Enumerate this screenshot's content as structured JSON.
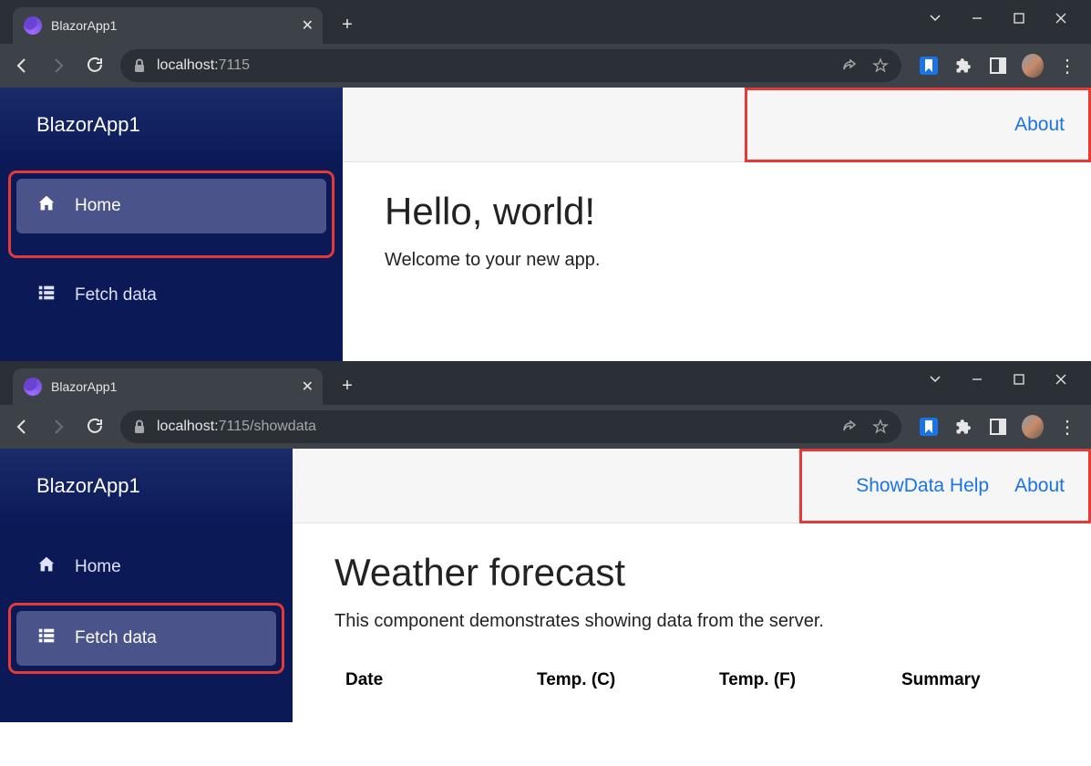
{
  "windows": [
    {
      "tab_title": "BlazorApp1",
      "url_host": "localhost:",
      "url_port": "7115",
      "url_path": "",
      "sidebar": {
        "brand": "BlazorApp1",
        "items": [
          {
            "label": "Home",
            "icon": "home-icon",
            "active": true
          },
          {
            "label": "Fetch data",
            "icon": "list-icon",
            "active": false
          }
        ]
      },
      "topbar_links": [
        "About"
      ],
      "page": {
        "heading": "Hello, world!",
        "intro": "Welcome to your new app."
      }
    },
    {
      "tab_title": "BlazorApp1",
      "url_host": "localhost:",
      "url_port": "7115",
      "url_path": "/showdata",
      "sidebar": {
        "brand": "BlazorApp1",
        "items": [
          {
            "label": "Home",
            "icon": "home-icon",
            "active": false
          },
          {
            "label": "Fetch data",
            "icon": "list-icon",
            "active": true
          }
        ]
      },
      "topbar_links": [
        "ShowData Help",
        "About"
      ],
      "page": {
        "heading": "Weather forecast",
        "intro": "This component demonstrates showing data from the server.",
        "table_headers": [
          "Date",
          "Temp. (C)",
          "Temp. (F)",
          "Summary"
        ]
      }
    }
  ],
  "icons": {
    "close": "✕",
    "plus": "+",
    "chevron_down": "˅"
  }
}
